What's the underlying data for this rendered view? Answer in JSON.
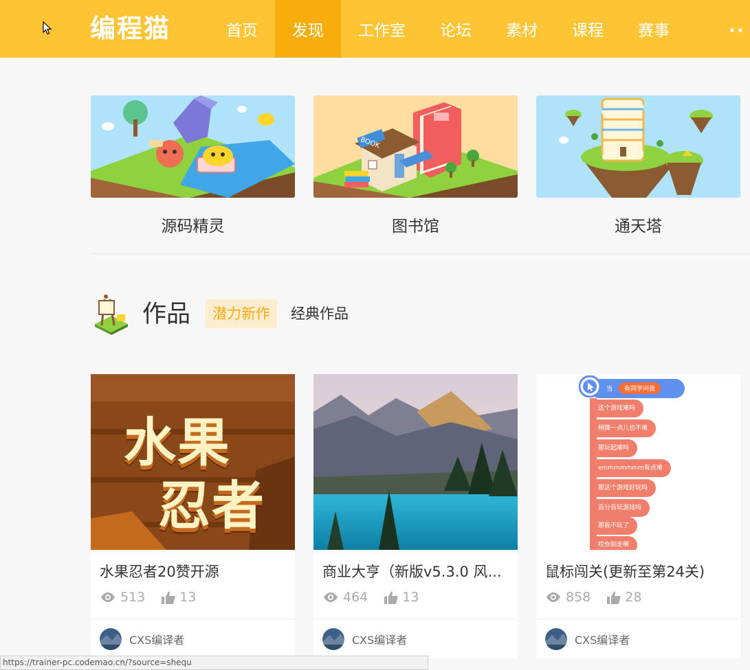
{
  "nav": {
    "logo": "编程猫",
    "items": [
      {
        "label": "首页"
      },
      {
        "label": "发现"
      },
      {
        "label": "工作室"
      },
      {
        "label": "论坛"
      },
      {
        "label": "素材"
      },
      {
        "label": "课程"
      },
      {
        "label": "赛事"
      }
    ],
    "more": "··",
    "active_index": 1
  },
  "features": [
    {
      "label": "源码精灵"
    },
    {
      "label": "图书馆"
    },
    {
      "label": "通天塔"
    }
  ],
  "works_section": {
    "title": "作品",
    "tabs": [
      {
        "label": "潜力新作",
        "active": true
      },
      {
        "label": "经典作品",
        "active": false
      }
    ]
  },
  "works": [
    {
      "title": "水果忍者20赞开源",
      "views": "513",
      "likes": "13",
      "author": "CXS编译者",
      "cover_text_1": "水果",
      "cover_text_2": "忍者"
    },
    {
      "title": "商业大亨（新版v5.3.0 风...",
      "views": "464",
      "likes": "13",
      "author": "CXS编译者"
    },
    {
      "title": "鼠标闯关(更新至第24关)",
      "views": "858",
      "likes": "28",
      "author": "CXS编译者",
      "blocks": [
        "当",
        "有同学问我",
        "这个游戏难吗",
        "稍微一点儿也不难",
        "那玩起难吗",
        "emmmmmmm有点难",
        "那这个游戏好玩吗",
        "百分百玩游戏吗",
        "那我不玩了",
        "哎你别走啊"
      ]
    }
  ],
  "status_url": "https://trainer-pc.codemao.cn/?source=shequ",
  "colors": {
    "brand": "#fec433",
    "nav_active": "#f5ae0b",
    "tab_active_text": "#f6ad13",
    "tab_active_bg": "#fdeccd"
  }
}
